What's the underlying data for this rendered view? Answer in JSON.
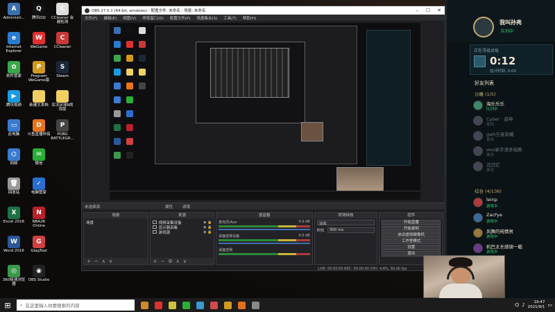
{
  "desktop": {
    "icons": [
      {
        "label": "Administr...",
        "color": "#3a6fb0",
        "glyph": "A"
      },
      {
        "label": "腾讯QQ",
        "color": "#111",
        "glyph": "Q"
      },
      {
        "label": "CCleaner 会\n越检测",
        "color": "#ddd",
        "glyph": "C"
      },
      {
        "label": "Internet\nExplorer",
        "color": "#2a7bd0",
        "glyph": "e"
      },
      {
        "label": "WeGame",
        "color": "#e03030",
        "glyph": "W"
      },
      {
        "label": "CCleaner",
        "color": "#c83a3a",
        "glyph": "C"
      },
      {
        "label": "软件管家",
        "color": "#3aa84a",
        "glyph": "✿"
      },
      {
        "label": "Program\nWeGame版",
        "color": "#d09a20",
        "glyph": "P"
      },
      {
        "label": "Steam",
        "color": "#1b2838",
        "glyph": "S"
      },
      {
        "label": "腾讯视频",
        "color": "#1a9be0",
        "glyph": "▶"
      },
      {
        "label": "新建文本档",
        "color": "#f0d060",
        "glyph": ""
      },
      {
        "label": "实况足球8闹\n改版",
        "color": "#f0d060",
        "glyph": ""
      },
      {
        "label": "此电脑",
        "color": "#3a7bd0",
        "glyph": "▭"
      },
      {
        "label": "斗鱼直播伴侣",
        "color": "#e8731a",
        "glyph": "D"
      },
      {
        "label": "PUBG\nBATTLEGR...",
        "color": "#444",
        "glyph": "P"
      },
      {
        "label": "网络",
        "color": "#3a7bd0",
        "glyph": "⌬"
      },
      {
        "label": "微信",
        "color": "#2aae36",
        "glyph": "✉"
      },
      {
        "label": "回收站",
        "color": "#999",
        "glyph": "🗑"
      },
      {
        "label": "电脑管家",
        "color": "#2a6fd0",
        "glyph": "✓"
      },
      {
        "label": "Excel 2016",
        "color": "#1e7145",
        "glyph": "X"
      },
      {
        "label": "NBA2K\nOnline",
        "color": "#b8202a",
        "glyph": "N"
      },
      {
        "label": "Word 2016",
        "color": "#2b579a",
        "glyph": "W"
      },
      {
        "label": "GlagTool",
        "color": "#d04040",
        "glyph": "G"
      },
      {
        "label": "360极速浏览\n器",
        "color": "#3a9a4a",
        "glyph": "◎"
      },
      {
        "label": "OBS Studio",
        "color": "#222",
        "glyph": "◉"
      }
    ]
  },
  "obs": {
    "title": "OBS 27.0.1 (64-bit, windows) - 配置文件: 未命名 - 场景: 未命名",
    "menu": [
      "文件(F)",
      "编辑(E)",
      "视图(V)",
      "停靠窗口(D)",
      "配置文件(P)",
      "场景集合(S)",
      "工具(T)",
      "帮助(H)"
    ],
    "dock_bar": {
      "properties": "属性",
      "filters": "滤镜",
      "no_source": "未选择源"
    },
    "scenes": {
      "header": "场景",
      "items": [
        "场景"
      ]
    },
    "sources": {
      "header": "来源",
      "items": [
        "视频采集设备",
        "显示器采集",
        "游戏源"
      ]
    },
    "mixer": {
      "header": "混音器",
      "channels": [
        {
          "name": "麦克风/Aux",
          "db": "0.0 dB"
        },
        {
          "name": "桌面音频设备",
          "db": "0.0 dB"
        },
        {
          "name": "桌面音频",
          "db": ""
        }
      ]
    },
    "transitions": {
      "header": "转场特效",
      "type": "淡出",
      "duration_label": "时长",
      "duration": "300 ms"
    },
    "controls": {
      "header": "控件",
      "buttons": [
        "开始直播",
        "开始录制",
        "启动虚拟摄像机",
        "工作室模式",
        "设置",
        "退出"
      ]
    },
    "status": "LIVE: 00:00:00   REC: 00:00:00   CPU: 4.6%, 60.00 fps"
  },
  "lol": {
    "username": "我叫孙亮",
    "status": "队列中",
    "queue_label": "正在寻找对局",
    "queue_time": "0:12",
    "estimated": "估计时间: 0:00",
    "friends_title": "好友列表",
    "groups": [
      {
        "name": "沙雕 (1/5)"
      },
      {
        "name": "综合 (4/136)"
      }
    ],
    "friends": [
      {
        "name": "海乐乐乐",
        "status": "队列中",
        "online": true,
        "color": "#3a8a6a"
      },
      {
        "name": "Cyber · 遊神",
        "status": "离线",
        "online": false,
        "color": "#445"
      },
      {
        "name": "gwh王者荣耀",
        "status": "离线",
        "online": false,
        "color": "#445"
      },
      {
        "name": "wxz新手请多指教",
        "status": "离线",
        "online": false,
        "color": "#445"
      },
      {
        "name": "沉沉忆",
        "status": "离线",
        "online": false,
        "color": "#445"
      },
      {
        "name": "leinp",
        "status": "游戏中",
        "online": true,
        "color": "#b03a3a"
      },
      {
        "name": "ZacFye",
        "status": "游戏中",
        "online": true,
        "color": "#3a6a9a"
      },
      {
        "name": "风舞的纯情男",
        "status": "游戏中",
        "online": true,
        "color": "#9a7a3a"
      },
      {
        "name": "机巴太长感谢一截",
        "status": "游戏中",
        "online": true,
        "color": "#6a3a8a"
      }
    ]
  },
  "taskbar": {
    "search_placeholder": "在这里输入你要搜索的内容",
    "apps": [
      "#d08a2a",
      "#e03030",
      "#d0c040",
      "#2aae36",
      "#3a9ad0",
      "#d04a4a",
      "#d09a20",
      "#e0701a",
      "#888"
    ],
    "time": "19:47",
    "date": "2021/9/1"
  }
}
